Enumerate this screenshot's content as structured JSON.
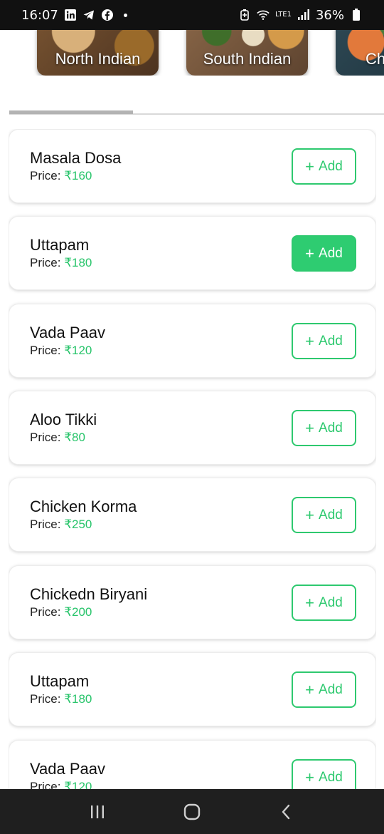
{
  "status_bar": {
    "time": "16:07",
    "battery": "36%",
    "network": "LTE1",
    "icons": [
      "linkedin-icon",
      "telegram-icon",
      "facebook-icon",
      "notification-dot",
      "battery-saver-icon",
      "wifi-icon",
      "signal-icon",
      "battery-icon"
    ]
  },
  "categories": [
    {
      "label": "North Indian"
    },
    {
      "label": "South Indian"
    },
    {
      "label": "Ch"
    }
  ],
  "menu_items": [
    {
      "name": "Masala Dosa",
      "price_label": "Price:",
      "price": "₹160",
      "add_label": "Add"
    },
    {
      "name": "Uttapam",
      "price_label": "Price:",
      "price": "₹180",
      "add_label": "Add"
    },
    {
      "name": "Vada Paav",
      "price_label": "Price:",
      "price": "₹120",
      "add_label": "Add"
    },
    {
      "name": "Aloo Tikki",
      "price_label": "Price:",
      "price": "₹80",
      "add_label": "Add"
    },
    {
      "name": "Chicken Korma",
      "price_label": "Price:",
      "price": "₹250",
      "add_label": "Add"
    },
    {
      "name": "Chickedn Biryani",
      "price_label": "Price:",
      "price": "₹200",
      "add_label": "Add"
    },
    {
      "name": "Uttapam",
      "price_label": "Price:",
      "price": "₹180",
      "add_label": "Add"
    },
    {
      "name": "Vada Paav",
      "price_label": "Price:",
      "price": "₹120",
      "add_label": "Add"
    }
  ],
  "colors": {
    "accent": "#2ecc71",
    "status_bar": "#111111",
    "nav_bar": "#1f1f1f"
  },
  "nav": {
    "icons": [
      "recent-apps-icon",
      "home-icon",
      "back-icon"
    ]
  }
}
